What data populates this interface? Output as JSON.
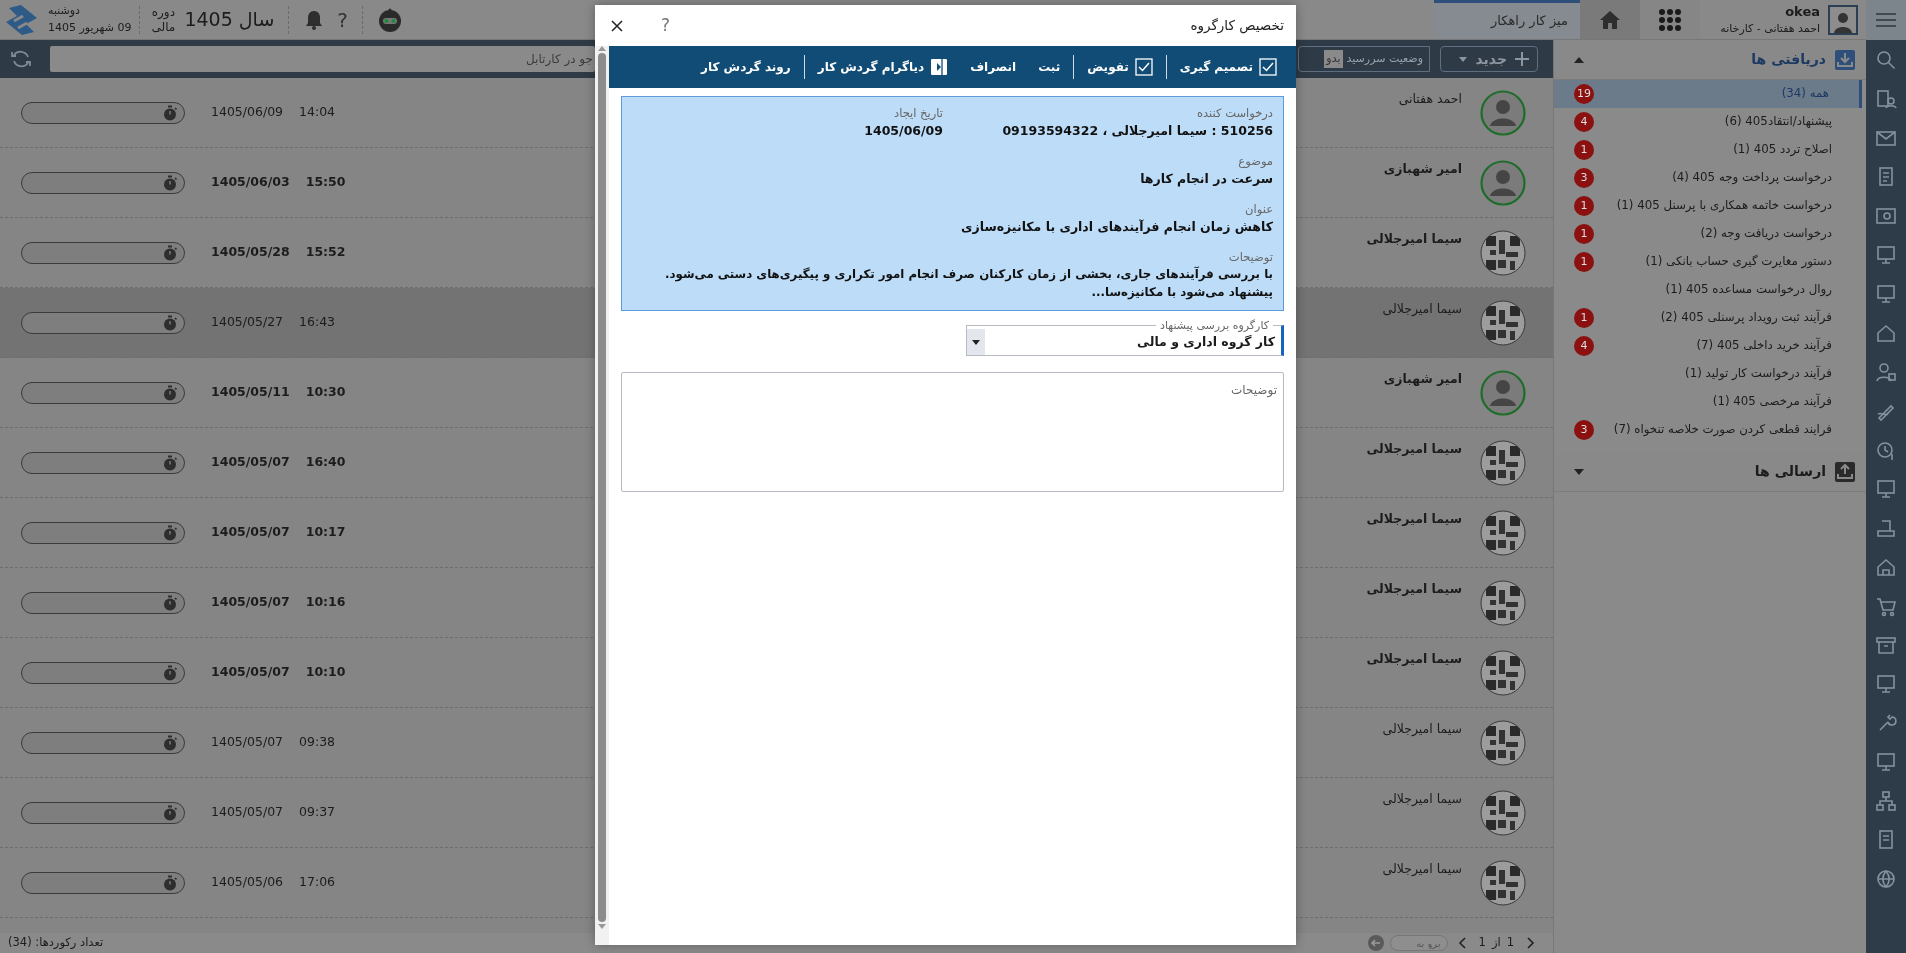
{
  "top_bar": {
    "day": "دوشنبه",
    "date": "09 شهریور 1405",
    "fiscal_label": "دوره مالی",
    "year": "سال 1405",
    "help": "?",
    "user_name": "okea",
    "user_detail": "احمد هفتانی - کارخانه",
    "tabs": [
      {
        "label": "میز کار راهکار",
        "selected": true
      }
    ]
  },
  "toolbar": {
    "search_placeholder": "جو در کارتابل",
    "due_status_label": "وضعیت سررسید",
    "due_status_value": "بدو",
    "new_button": "جدید"
  },
  "rows": [
    {
      "name": "احمد هفتانی",
      "date": "1405/06/09",
      "time": "14:04",
      "unread": false,
      "selected": false,
      "kind": "silhouette"
    },
    {
      "name": "امیر شهبازی",
      "date": "1405/06/03",
      "time": "15:50",
      "unread": true,
      "selected": false,
      "kind": "silhouette"
    },
    {
      "name": "سیما امیرجلالی",
      "date": "1405/05/28",
      "time": "15:52",
      "unread": true,
      "selected": false,
      "kind": "pattern"
    },
    {
      "name": "سیما امیرجلالی",
      "date": "1405/05/27",
      "time": "16:43",
      "unread": false,
      "selected": true,
      "kind": "pattern"
    },
    {
      "name": "امیر شهبازی",
      "date": "1405/05/11",
      "time": "10:30",
      "unread": true,
      "selected": false,
      "kind": "silhouette"
    },
    {
      "name": "سیما امیرجلالی",
      "date": "1405/05/07",
      "time": "16:40",
      "unread": true,
      "selected": false,
      "kind": "pattern"
    },
    {
      "name": "سیما امیرجلالی",
      "date": "1405/05/07",
      "time": "10:17",
      "unread": true,
      "selected": false,
      "kind": "pattern"
    },
    {
      "name": "سیما امیرجلالی",
      "date": "1405/05/07",
      "time": "10:16",
      "unread": true,
      "selected": false,
      "kind": "pattern"
    },
    {
      "name": "سیما امیرجلالی",
      "date": "1405/05/07",
      "time": "10:10",
      "unread": true,
      "selected": false,
      "kind": "pattern"
    },
    {
      "name": "سیما امیرجلالی",
      "date": "1405/05/07",
      "time": "09:38",
      "unread": false,
      "selected": false,
      "kind": "pattern"
    },
    {
      "name": "سیما امیرجلالی",
      "date": "1405/05/07",
      "time": "09:37",
      "unread": false,
      "selected": false,
      "kind": "pattern"
    },
    {
      "name": "سیما امیرجلالی",
      "date": "1405/05/06",
      "time": "17:06",
      "unread": false,
      "selected": false,
      "kind": "pattern"
    }
  ],
  "footer": {
    "records": "تعداد رکوردها: (34)",
    "page": "1",
    "of_label": "از",
    "page_count": "1",
    "goto_placeholder": "برو به"
  },
  "sections": [
    {
      "title": "دریافتی ها",
      "kind": "inbox",
      "expanded": true,
      "items": [
        {
          "label": "همه (34)",
          "badge": "19",
          "selected": true
        },
        {
          "label": "پیشنهاد/انتقاد405 (6)",
          "badge": "4",
          "selected": false
        },
        {
          "label": "اصلاح تردد 405 (1)",
          "badge": "1",
          "selected": false
        },
        {
          "label": "درخواست پرداخت وجه 405 (4)",
          "badge": "3",
          "selected": false
        },
        {
          "label": "درخواست خاتمه همکاری با پرسنل 405 (1)",
          "badge": "1",
          "selected": false
        },
        {
          "label": "درخواست دریافت وجه (2)",
          "badge": "1",
          "selected": false
        },
        {
          "label": "دستور مغایرت گیری حساب بانکی (1)",
          "badge": "1",
          "selected": false
        },
        {
          "label": "روال درخواست مساعده 405 (1)",
          "selected": false
        },
        {
          "label": "فرآیند ثبت رویداد پرسنلی 405 (2)",
          "badge": "1",
          "selected": false
        },
        {
          "label": "فرآیند خرید داخلی 405 (7)",
          "badge": "4",
          "selected": false
        },
        {
          "label": "فرآیند درخواست کار تولید (1)",
          "selected": false
        },
        {
          "label": "فرآیند مرخصی 405 (1)",
          "selected": false
        },
        {
          "label": "فرایند قطعی کردن صورت خلاصه تنخواه (7)",
          "badge": "3",
          "selected": false
        }
      ]
    },
    {
      "title": "ارسالی ها",
      "kind": "outbox",
      "expanded": false
    }
  ],
  "modal": {
    "title": "تخصیص کارگروه",
    "help": "?",
    "actions": [
      {
        "label": "تصمیم گیری",
        "kind": "check",
        "divider_after": true
      },
      {
        "label": "تفویض",
        "kind": "check",
        "divider_after": true
      },
      {
        "label": "ثبت",
        "kind": "plain",
        "divider_after": false
      },
      {
        "label": "انصراف",
        "kind": "plain",
        "divider_after": false
      },
      {
        "label": "دیاگرام گردش کار",
        "kind": "panel",
        "divider_after": true
      },
      {
        "label": "روند گردش کار",
        "kind": "plain",
        "divider_after": false
      }
    ],
    "info": {
      "requester_label": "درخواست کننده",
      "requester": "510256 : سیما امیرجلالی ، 09193594322",
      "created_label": "تاریخ ایجاد",
      "created": "1405/06/09",
      "subject_label": "موضوع",
      "subject": "سرعت در انجام کارها",
      "title_label": "عنوان",
      "title": "کاهش زمان انجام فرآیندهای اداری با مکانیزه‌سازی",
      "description_label": "توضیحات",
      "description": "با بررسی فرآیندهای جاری، بخشی از زمان کارکنان صرف انجام امور تکراری و پیگیری‌های دستی می‌شود. پیشنهاد می‌شود با مکانیزه‌سا..."
    },
    "workgroup": {
      "label": "کارگروه بررسی پیشنهاد",
      "value": "کار گروه اداری و مالی"
    },
    "notes": {
      "placeholder": "توضیحات"
    }
  }
}
